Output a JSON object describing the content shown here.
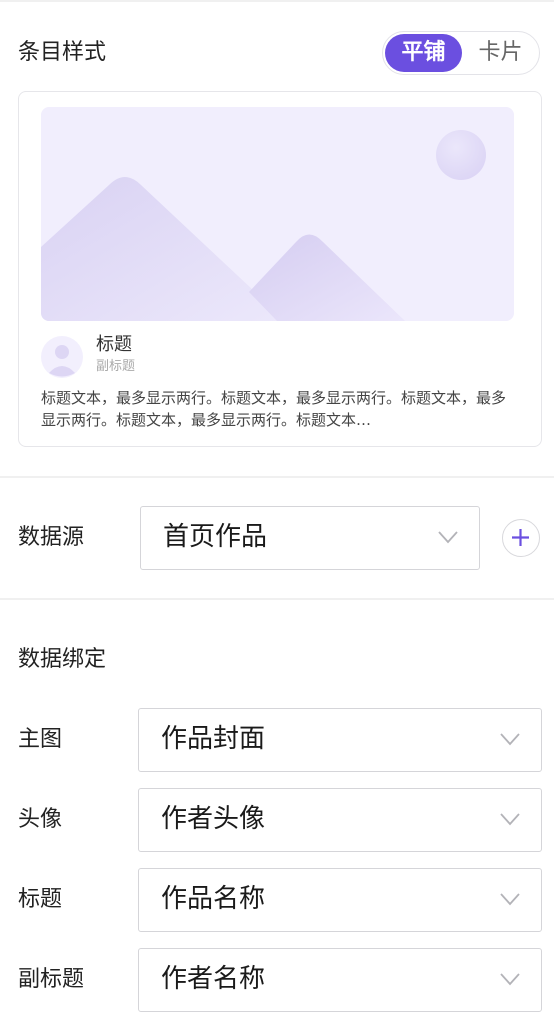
{
  "item_style": {
    "label": "条目样式",
    "options": [
      "平铺",
      "卡片"
    ],
    "selected": "平铺"
  },
  "preview": {
    "title": "标题",
    "subtitle": "副标题",
    "body": "标题文本，最多显示两行。标题文本，最多显示两行。标题文本，最多显示两行。标题文本，最多显示两行。标题文本…"
  },
  "data_source": {
    "label": "数据源",
    "value": "首页作品"
  },
  "data_binding": {
    "heading": "数据绑定",
    "fields": [
      {
        "label": "主图",
        "value": "作品封面"
      },
      {
        "label": "头像",
        "value": "作者头像"
      },
      {
        "label": "标题",
        "value": "作品名称"
      },
      {
        "label": "副标题",
        "value": "作者名称"
      }
    ]
  },
  "colors": {
    "accent": "#6b4fe0",
    "placeholder_bg": "#f1eefd"
  }
}
